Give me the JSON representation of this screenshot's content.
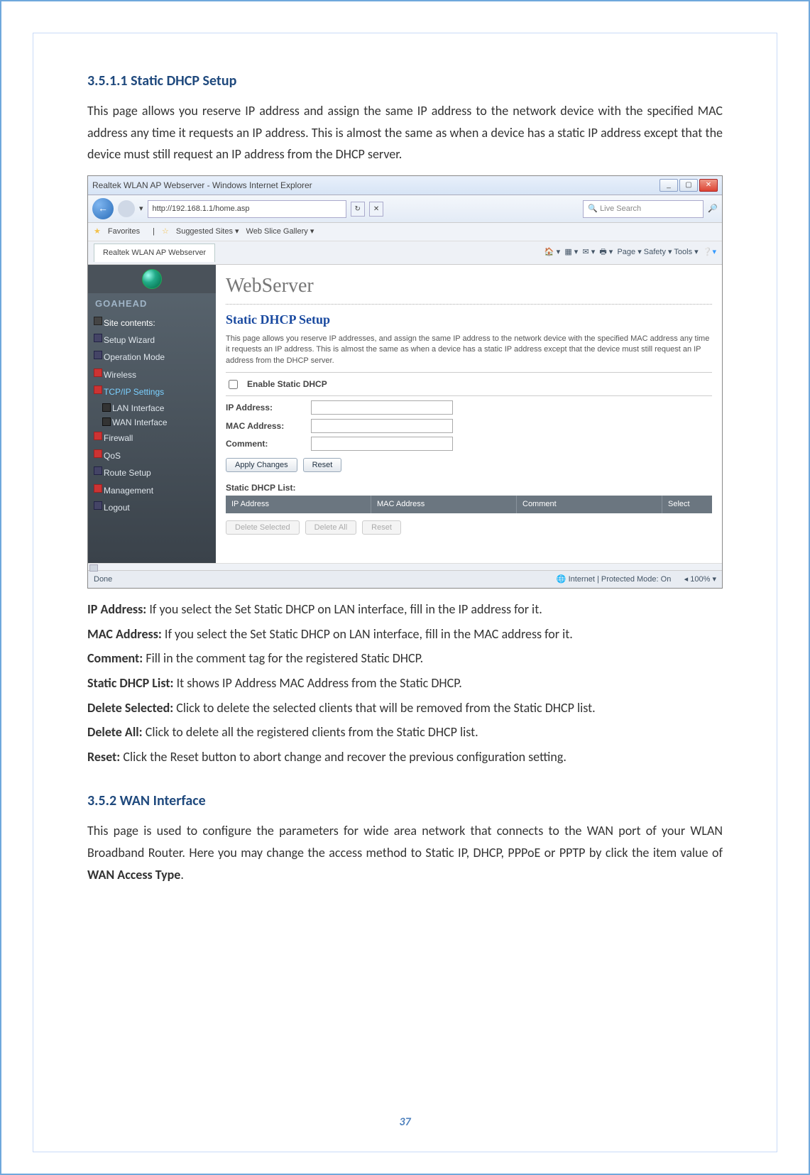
{
  "section1": {
    "heading": "3.5.1.1  Static DHCP Setup",
    "intro": "This page allows you reserve IP address and assign the same IP address to the network device with the specified MAC address any time it requests an IP address. This is almost the same as when a device has a static IP address except that the device must still request an IP address from the DHCP server."
  },
  "browser": {
    "window_title": "Realtek WLAN AP Webserver - Windows Internet Explorer",
    "url": "http://192.168.1.1/home.asp",
    "search_placeholder": "Live Search",
    "fav_label": "Favorites",
    "fav_links": {
      "suggested": "Suggested Sites ▾",
      "webslice": "Web Slice Gallery ▾"
    },
    "tab_label": "Realtek WLAN AP Webserver",
    "tool_menu": "Page ▾   Safety ▾   Tools ▾",
    "brand": "GOAHEAD",
    "ws_title": "WebServer",
    "sidebar": {
      "site_contents": "Site contents:",
      "items": [
        "Setup Wizard",
        "Operation Mode",
        "Wireless",
        "TCP/IP Settings",
        "Firewall",
        "QoS",
        "Route Setup",
        "Management",
        "Logout"
      ],
      "sub": {
        "lan": "LAN Interface",
        "wan": "WAN Interface"
      }
    },
    "page": {
      "title": "Static DHCP Setup",
      "desc": "This page allows you reserve IP addresses, and assign the same IP address to the network device with the specified MAC address any time it requests an IP address. This is almost the same as when a device has a static IP address except that the device must still request an IP address from the DHCP server.",
      "enable_label": "Enable Static DHCP",
      "ip_label": "IP Address:",
      "mac_label": "MAC Address:",
      "comment_label": "Comment:",
      "apply_btn": "Apply Changes",
      "reset_btn": "Reset",
      "list_title": "Static DHCP List:",
      "cols": {
        "ip": "IP Address",
        "mac": "MAC Address",
        "comment": "Comment",
        "select": "Select"
      },
      "del_sel": "Delete Selected",
      "del_all": "Delete All",
      "reset2": "Reset"
    },
    "status": {
      "done": "Done",
      "mode": "Internet | Protected Mode: On",
      "zoom": "100%"
    }
  },
  "fields": {
    "ip": {
      "label": "IP Address:",
      "text": "If you select the Set Static DHCP on LAN interface, fill in the IP address for it."
    },
    "mac": {
      "label": "MAC Address:",
      "text": "If you select the Set Static DHCP on LAN interface, fill in the MAC address for it."
    },
    "comment": {
      "label": "Comment:",
      "text": "Fill in the comment tag for the registered Static DHCP."
    },
    "list": {
      "label": "Static DHCP List:",
      "text": "It shows IP Address MAC Address from the Static DHCP."
    },
    "delsel": {
      "label": "Delete Selected:",
      "text": "Click to delete the selected clients that will be removed from the Static DHCP list."
    },
    "delall": {
      "label": "Delete All:",
      "text": "Click to delete all the registered clients from the Static DHCP list."
    },
    "reset": {
      "label": "Reset:",
      "text": "Click the Reset button to abort change and recover the previous configuration setting."
    }
  },
  "section2": {
    "heading": "3.5.2    WAN Interface",
    "intro_a": "This page is used to configure the parameters for wide area network that connects to the WAN port of your WLAN Broadband Router. Here you may change the access method to Static IP, DHCP, PPPoE or PPTP by click the item value of ",
    "intro_b": "WAN Access Type",
    "intro_c": "."
  },
  "page_number": "37"
}
